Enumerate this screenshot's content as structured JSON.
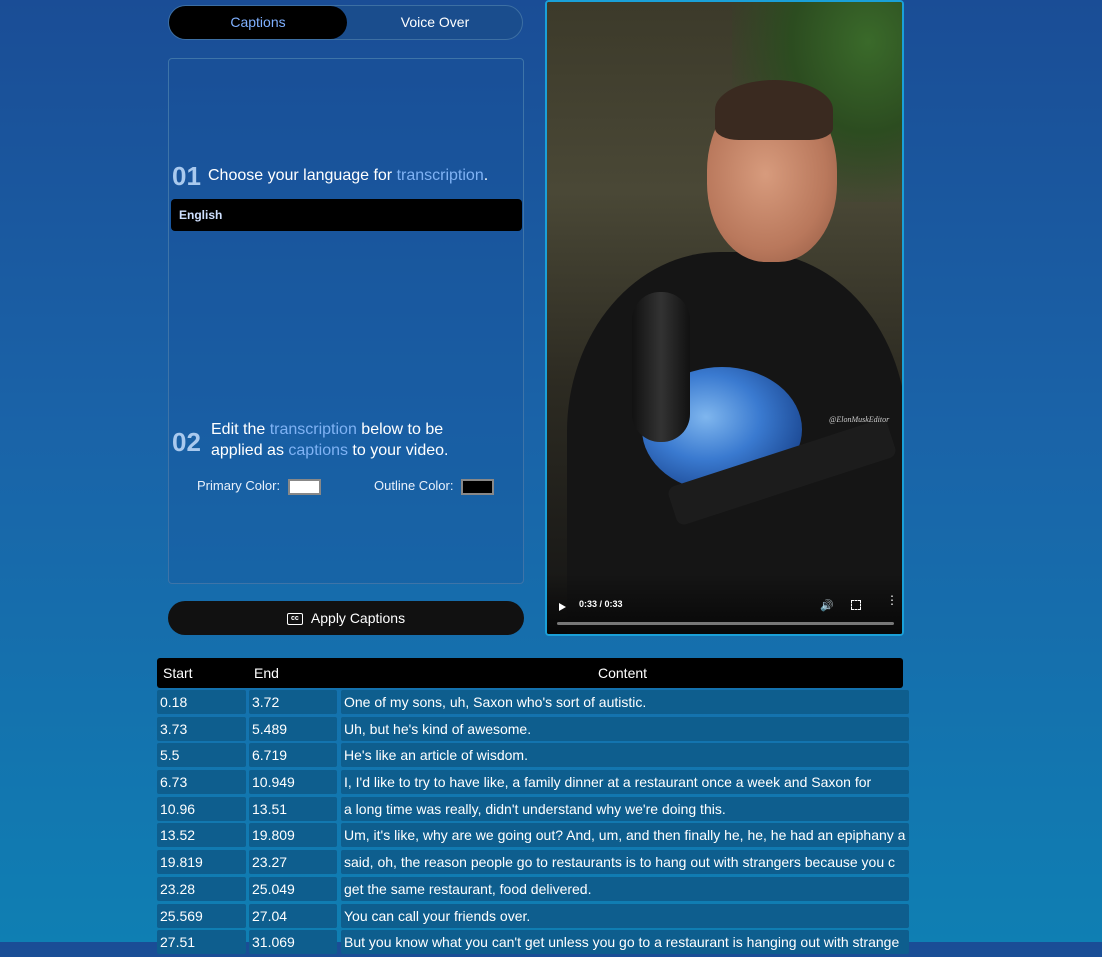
{
  "tabs": {
    "captions": "Captions",
    "voice_over": "Voice Over"
  },
  "step1": {
    "num": "01",
    "text_before": "Choose your language for ",
    "text_highlight": "transcription",
    "text_after": ".",
    "language": "English"
  },
  "step2": {
    "num": "02",
    "line1_before": "Edit the ",
    "line1_highlight": "transcription",
    "line1_after": " below to be",
    "line2_before": "applied as ",
    "line2_highlight": "captions",
    "line2_after": " to your video.",
    "primary_label": "Primary Color:",
    "primary_color": "#ffffff",
    "outline_label": "Outline Color:",
    "outline_color": "#000000"
  },
  "apply_button": {
    "icon": "cc-icon",
    "label": "Apply Captions"
  },
  "video": {
    "time": "0:33 / 0:33",
    "watermark": "@ElonMuskEditor",
    "progress": 1.0
  },
  "table": {
    "headers": {
      "start": "Start",
      "end": "End",
      "content": "Content"
    },
    "rows": [
      {
        "start": "0.18",
        "end": "3.72",
        "content": "One of my sons, uh, Saxon who's sort of autistic."
      },
      {
        "start": "3.73",
        "end": "5.489",
        "content": "Uh, but he's kind of awesome."
      },
      {
        "start": "5.5",
        "end": "6.719",
        "content": "He's like an article of wisdom."
      },
      {
        "start": "6.73",
        "end": "10.949",
        "content": "I, I'd like to try to have like, a family dinner at a restaurant once a week and Saxon for"
      },
      {
        "start": "10.96",
        "end": "13.51",
        "content": "a long time was really, didn't understand why we're doing this."
      },
      {
        "start": "13.52",
        "end": "19.809",
        "content": "Um, it's like, why are we going out? And, um, and then finally he, he, he had an epiphany a"
      },
      {
        "start": "19.819",
        "end": "23.27",
        "content": "said, oh, the reason people go to restaurants is to hang out with strangers because you c"
      },
      {
        "start": "23.28",
        "end": "25.049",
        "content": "get the same restaurant, food delivered."
      },
      {
        "start": "25.569",
        "end": "27.04",
        "content": "You can call your friends over."
      },
      {
        "start": "27.51",
        "end": "31.069",
        "content": "But you know what you can't get unless you go to a restaurant is hanging out with strange"
      }
    ]
  }
}
